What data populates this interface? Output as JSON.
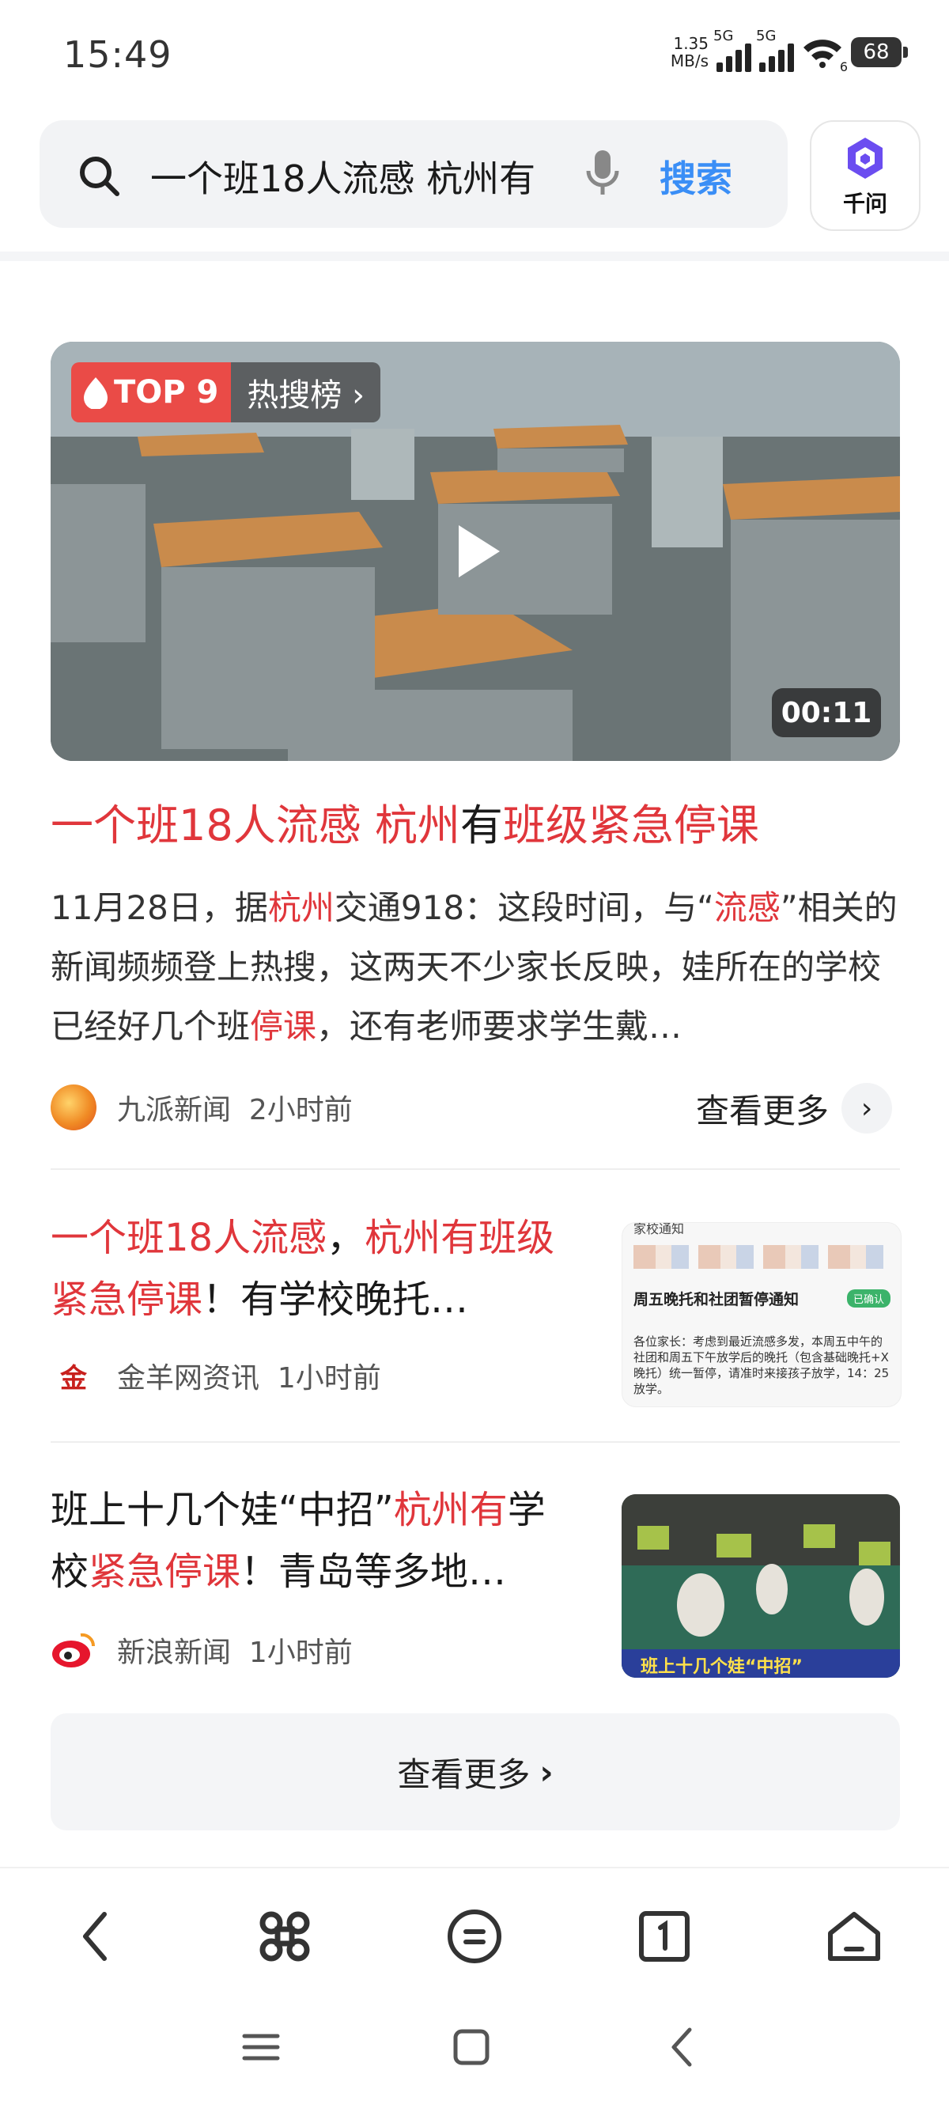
{
  "status": {
    "time": "15:49",
    "net_speed": "1.35",
    "net_unit": "MB/s",
    "sig1": "5G",
    "sig2": "5G",
    "wifi_sub": "6",
    "battery": "68"
  },
  "search": {
    "query": "一个班18人流感 杭州有",
    "button": "搜索",
    "assistant_label": "千问"
  },
  "video_card": {
    "rank_label": "TOP 9",
    "board_label": "热搜榜 ›",
    "duration": "00:11",
    "title_parts": [
      "一个班18人流感 杭州",
      "有",
      "班级紧急停课"
    ],
    "desc_parts": [
      "11月28日，据",
      "杭州",
      "交通918：这段时间，与“",
      "流感",
      "”相关的新闻频频登上热搜，这两天不少家长反映，娃所在的学校已经好几个班",
      "停课",
      "，还有老师要求学生戴…"
    ],
    "source": "九派新闻",
    "time_ago": "2小时前",
    "more": "查看更多"
  },
  "news_items": [
    {
      "title_parts": [
        "一个班18人流感",
        "，",
        "杭州有班级紧急停课",
        "！有学校晚托…"
      ],
      "source": "金羊网资讯",
      "time_ago": "1小时前",
      "thumb": {
        "header": "家校通知",
        "heading": "周五晚托和社团暂停通知",
        "badge": "已确认",
        "body": "各位家长：考虑到最近流感多发，本周五中午的社团和周五下午放学后的晚托（包含基础晚托+X晚托）统一暂停，请准时来接孩子放学，14：25放学。"
      }
    },
    {
      "title_parts": [
        "班上十几个娃“中招”",
        "杭州有",
        "学校",
        "紧急停课",
        "！青岛等多地…"
      ],
      "source": "新浪新闻",
      "time_ago": "1小时前",
      "thumb": {
        "caption": "班上十几个娃“中招”"
      }
    }
  ],
  "more_bar": "查看更多",
  "colors": {
    "highlight": "#e0363b",
    "accent": "#3a8ef6"
  }
}
